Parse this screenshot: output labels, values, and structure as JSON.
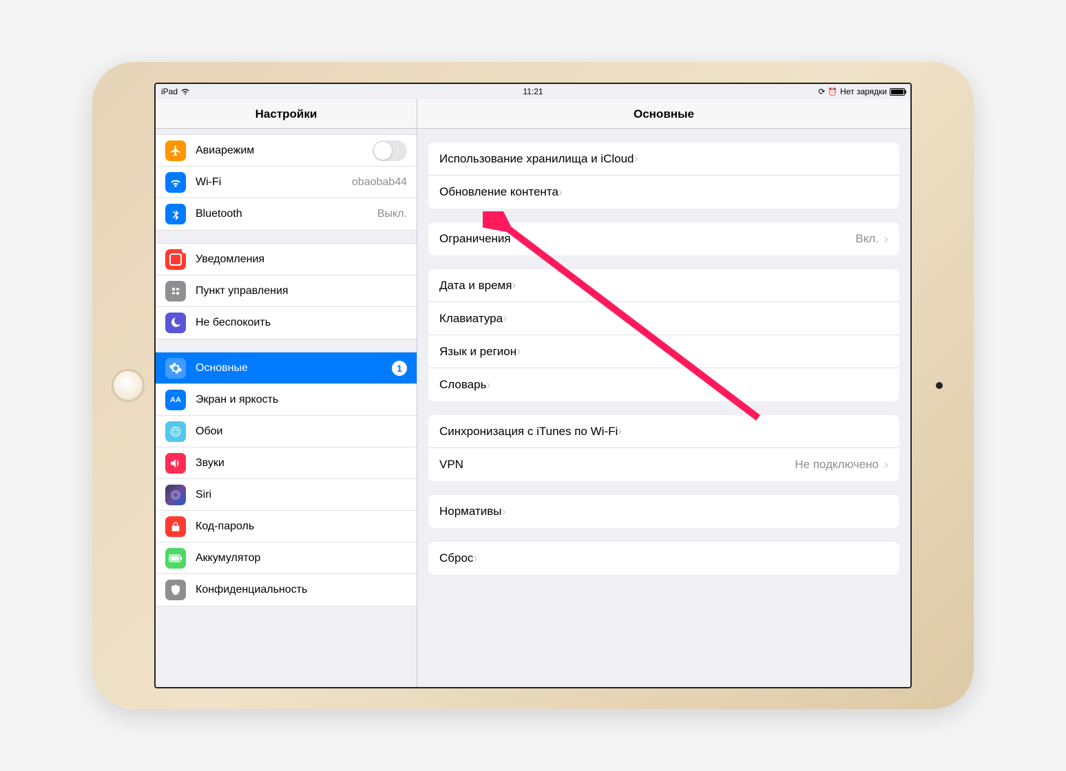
{
  "status": {
    "device": "iPad",
    "time": "11:21",
    "charge": "Нет зарядки"
  },
  "sidebar": {
    "title": "Настройки",
    "groups": [
      [
        {
          "id": "airplane",
          "label": "Авиарежим",
          "type": "toggle"
        },
        {
          "id": "wifi",
          "label": "Wi-Fi",
          "value": "obaobab44"
        },
        {
          "id": "bluetooth",
          "label": "Bluetooth",
          "value": "Выкл."
        }
      ],
      [
        {
          "id": "notifications",
          "label": "Уведомления"
        },
        {
          "id": "control-center",
          "label": "Пункт управления"
        },
        {
          "id": "dnd",
          "label": "Не беспокоить"
        }
      ],
      [
        {
          "id": "general",
          "label": "Основные",
          "selected": true,
          "badge": "1"
        },
        {
          "id": "display",
          "label": "Экран и яркость"
        },
        {
          "id": "wallpaper",
          "label": "Обои"
        },
        {
          "id": "sounds",
          "label": "Звуки"
        },
        {
          "id": "siri",
          "label": "Siri"
        },
        {
          "id": "passcode",
          "label": "Код-пароль"
        },
        {
          "id": "battery",
          "label": "Аккумулятор"
        },
        {
          "id": "privacy",
          "label": "Конфиденциальность"
        }
      ]
    ]
  },
  "detail": {
    "title": "Основные",
    "groups": [
      [
        {
          "id": "storage",
          "label": "Использование хранилища и iCloud"
        },
        {
          "id": "bgrefresh",
          "label": "Обновление контента"
        }
      ],
      [
        {
          "id": "restrictions",
          "label": "Ограничения",
          "value": "Вкл."
        }
      ],
      [
        {
          "id": "datetime",
          "label": "Дата и время"
        },
        {
          "id": "keyboard",
          "label": "Клавиатура"
        },
        {
          "id": "language",
          "label": "Язык и регион"
        },
        {
          "id": "dictionary",
          "label": "Словарь"
        }
      ],
      [
        {
          "id": "itunes",
          "label": "Синхронизация с iTunes по Wi-Fi"
        },
        {
          "id": "vpn",
          "label": "VPN",
          "value": "Не подключено"
        }
      ],
      [
        {
          "id": "regulatory",
          "label": "Нормативы"
        }
      ],
      [
        {
          "id": "reset",
          "label": "Сброс"
        }
      ]
    ]
  }
}
